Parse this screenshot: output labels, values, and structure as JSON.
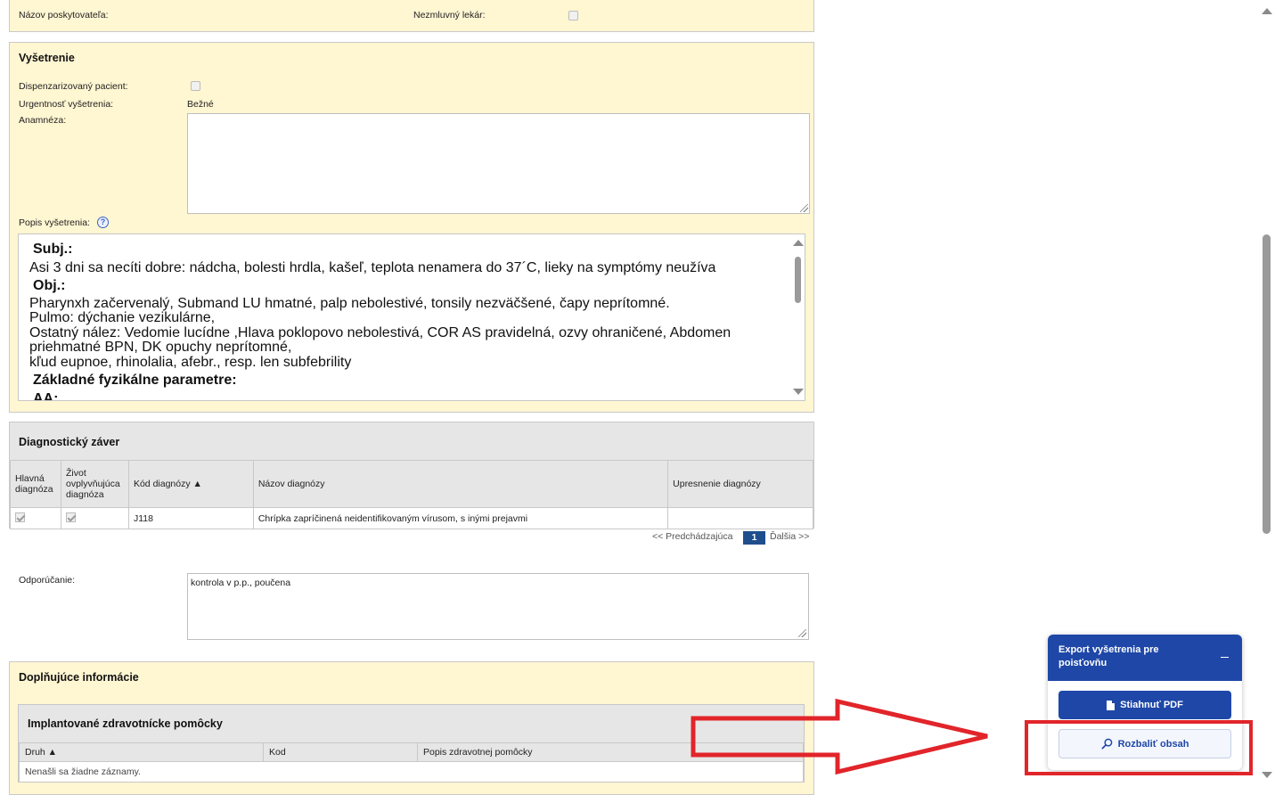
{
  "provider_section": {
    "provider_name_label": "Názov poskytovateľa:",
    "noncontract_doctor_label": "Nezmluvný lekár:"
  },
  "examination": {
    "title": "Vyšetrenie",
    "dispensary_label": "Dispenzarizovaný pacient:",
    "urgency_label": "Urgentnosť vyšetrenia:",
    "urgency_value": "Bežné",
    "anamnesis_label": "Anamnéza:",
    "anamnesis_value": "",
    "description_label": "Popis vyšetrenia:",
    "help_glyph": "?",
    "description": {
      "subj_heading": "Subj.:",
      "subj_text": "Asi 3 dni sa necíti dobre: nádcha, bolesti hrdla, kašeľ, teplota nenamera do 37´C, lieky na symptómy neužíva",
      "obj_heading": "Obj.:",
      "obj_lines": [
        "Pharynxh začervenalý, Submand LU hmatné, palp nebolestivé, tonsily nezväčšené, čapy neprítomné.",
        "Pulmo: dýchanie vezikulárne,",
        "Ostatný nález: Vedomie lucídne ,Hlava poklopovo nebolestivá, COR AS pravidelná, ozvy ohraničené, Abdomen",
        "priehmatné BPN, DK opuchy neprítomné,",
        "kľud eupnoe, rhinolalia, afebr., resp. len subfebrility"
      ],
      "params_heading": "Základné fyzikálne parametre:",
      "aa_heading": "AA:"
    }
  },
  "diagnosis": {
    "title": "Diagnostický záver",
    "columns": {
      "main": [
        "Hlavná",
        "diagnóza"
      ],
      "life": [
        "Život",
        "ovplyvňujúca",
        "diagnóza"
      ],
      "code": "Kód diagnózy ▲",
      "name": "Názov diagnózy",
      "detail": "Upresnenie diagnózy"
    },
    "rows": [
      {
        "code": "J118",
        "name": "Chrípka zapríčinená neidentifikovaným vírusom, s inými prejavmi",
        "detail": ""
      }
    ],
    "pager": {
      "prev": "<< Predchádzajúca",
      "page": "1",
      "next": "Ďalšia >>"
    }
  },
  "recommendation": {
    "label": "Odporúčanie:",
    "value": "kontrola v p.p., poučena"
  },
  "supplementary": {
    "title": "Doplňujúce informácie",
    "implants": {
      "title": "Implantované zdravotnícke pomôcky",
      "columns": {
        "type": "Druh ▲",
        "code": "Kod",
        "desc": "Popis zdravotnej pomôcky"
      },
      "empty": "Nenašli sa žiadne záznamy."
    }
  },
  "export_widget": {
    "title": "Export vyšetrenia pre poisťovňu",
    "collapse": "–",
    "pdf_button": "Stiahnuť PDF",
    "expand_button": "Rozbaliť obsah"
  },
  "colors": {
    "panel_yellow": "#fff6d2",
    "accent_blue": "#1e47a8",
    "annotation_red": "#e1252a"
  }
}
